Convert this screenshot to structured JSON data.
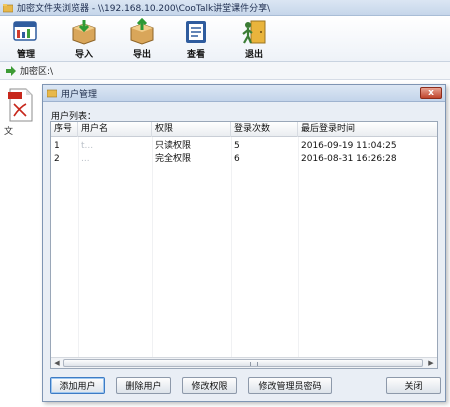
{
  "window": {
    "title": "加密文件夹浏览器 - \\\\192.168.10.200\\CooTalk讲堂课件分享\\"
  },
  "toolbar": {
    "buttons": [
      {
        "label": "管理",
        "icon": "manage-icon"
      },
      {
        "label": "导入",
        "icon": "import-icon"
      },
      {
        "label": "导出",
        "icon": "export-icon"
      },
      {
        "label": "查看",
        "icon": "view-icon"
      },
      {
        "label": "退出",
        "icon": "exit-icon"
      }
    ]
  },
  "address": {
    "path": "加密区:\\"
  },
  "files": [
    {
      "label": "文",
      "icon": "pdf-file-icon"
    }
  ],
  "dialog": {
    "title": "用户管理",
    "close_label": "x",
    "list_caption": "用户列表：",
    "columns": [
      "序号",
      "用户名",
      "权限",
      "登录次数",
      "最后登录时间"
    ],
    "rows": [
      {
        "index": "1",
        "username": "t...",
        "permission": "只读权限",
        "login_count": "5",
        "last_login": "2016-09-19 11:04:25"
      },
      {
        "index": "2",
        "username": "...",
        "permission": "完全权限",
        "login_count": "6",
        "last_login": "2016-08-31 16:26:28"
      }
    ],
    "buttons": {
      "add_user": "添加用户",
      "delete_user": "删除用户",
      "modify_permission": "修改权限",
      "modify_admin_password": "修改管理员密码",
      "close": "关闭"
    }
  }
}
